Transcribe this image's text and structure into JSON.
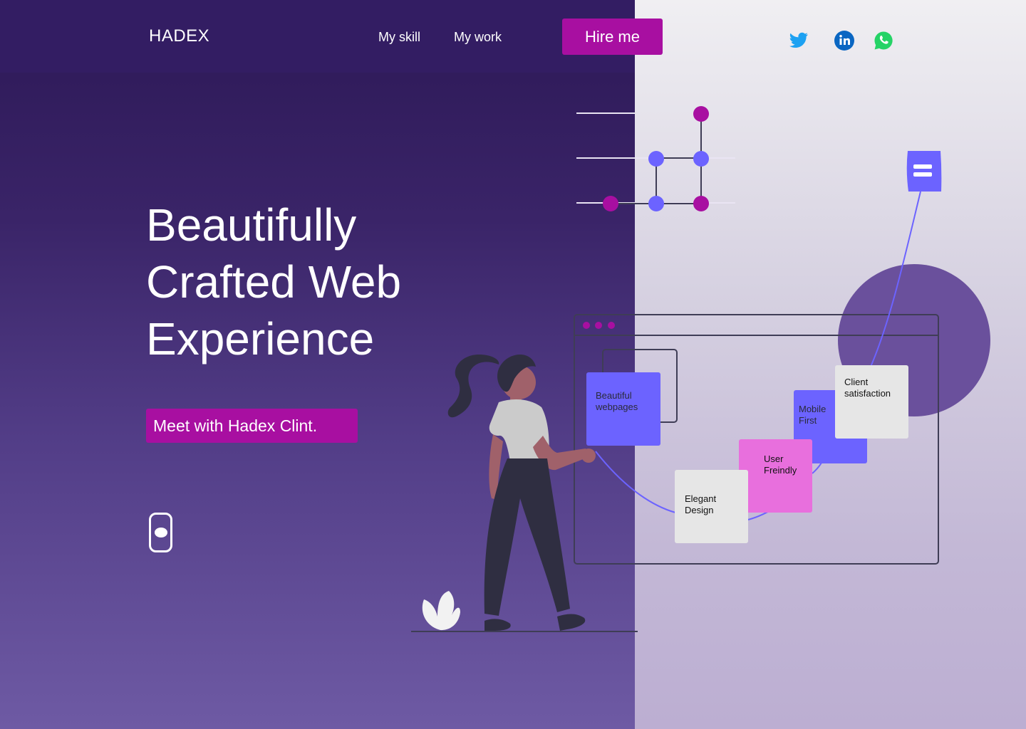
{
  "brand": {
    "logo": "HADEX"
  },
  "nav": {
    "items": [
      {
        "label": "My skill"
      },
      {
        "label": "My work"
      }
    ],
    "hire_label": "Hire me"
  },
  "social": [
    {
      "name": "twitter-icon",
      "color": "#1da1f2"
    },
    {
      "name": "linkedin-icon",
      "color": "#0a66c2"
    },
    {
      "name": "whatsapp-icon",
      "color": "#25d366"
    }
  ],
  "hero": {
    "title_lines": [
      "Beautifully",
      "Crafted Web",
      "Experience"
    ],
    "cta_label": "Meet with Hadex Clint."
  },
  "cards": {
    "beautiful": {
      "line1": "Beautiful",
      "line2": "webpages"
    },
    "elegant": {
      "line1": "Elegant",
      "line2": "Design"
    },
    "user": {
      "line1": "User",
      "line2": "Freindly"
    },
    "mobile": {
      "line1": "Mobile",
      "line2": "First"
    },
    "client": {
      "line1": "Client",
      "line2": "satisfaction"
    }
  },
  "colors": {
    "accent": "#a80fa1",
    "violet": "#6c63ff",
    "pink": "#e86fdd",
    "header": "#331d63"
  }
}
